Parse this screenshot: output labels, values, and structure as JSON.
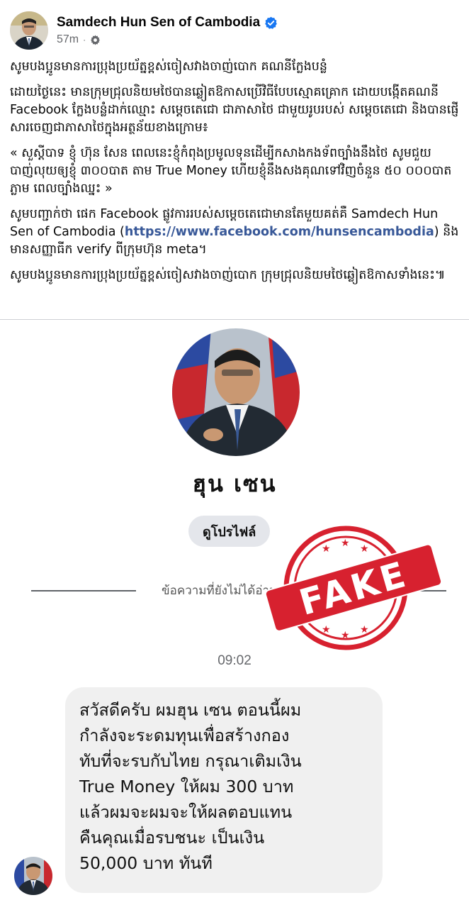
{
  "post": {
    "author": "Samdech Hun Sen of Cambodia",
    "time": "57m",
    "paragraphs": [
      "សូមបងប្អូនមានការប្រុងប្រយ័ត្នខ្ពស់ចៀសវាងចាញ់បោក គណនីក្លែងបន្លំ",
      "ដោយថ្ងៃនេះ  មានក្រុមជ្រុលនិយមថៃបានឆ្លៀតឱកាសប្រើវិធីបែបស្មោគគ្រោក ដោយបង្កើតគណនី Facebook ក្លែងបន្លំដាក់ឈ្មោះ សម្តេចតេជោ ជាភាសាថៃ ជាមួយរូបរបស់ សម្តេចតេជោ និងបានផ្ញើសារចេញជាភាសាថៃក្នុងអត្ថន័យខាងក្រោម៖",
      "« សួស្តីបាទ ខ្ញុំ ហ៊ុន សែន ពេលនេះខ្ញុំកំពុងប្រមូលទុនដើម្បីកសាងកងទ័ពច្បាំងនឹងថៃ សូមជួយបាញ់លុយឲ្យខ្ញុំ ៣០០បាត តាម True Money ហើយខ្ញុំនឹងសងគុណទៅវិញចំនួន ៥០ ០០០បាតភ្លាម ពេលច្បាំងឈ្នះ »"
    ],
    "confirm_before": "សូមបញ្ជាក់ថា ផេក Facebook ផ្លូវការរបស់សម្តេចតេជោមានតែមួយគត់គឺ Samdech Hun Sen of Cambodia (",
    "confirm_link": "https://www.facebook.com/hunsencambodia",
    "confirm_after": ") និងមានសញ្ញាធីក verify ពីក្រុមហ៊ុន meta។",
    "closing": "សូមបងប្អូនមានការប្រុងប្រយ័ត្នខ្ពស់ចៀសវាងចាញ់បោក ក្រុមជ្រុលនិយមថៃឆ្លៀតឱកាសទាំងនេះ៕"
  },
  "chat": {
    "profile_name": "ฮุน  เซน",
    "view_profile_label": "ดูโปรไฟล์",
    "unread_label": "ข้อความที่ยังไม่ได้อ่าน",
    "stamp_text": "FAKE",
    "timestamp": "09:02",
    "message_lines": [
      "สวัสดีครับ ผมฮุน เซน ตอนนี้ผม",
      "กำลังจะระดมทุนเพื่อสร้างกอง",
      "ทับที่จะรบกับไทย กรุณาเติมเงิน",
      "True Money ให้ผม 300 บาท",
      "แล้วผมจะผมจะให้ผลตอบแทน",
      "คืนคุณเมื่อรบชนะ เป็นเงิน",
      "50,000 บาท ทันที"
    ]
  },
  "icons": {
    "verified": "verified-badge-icon",
    "audience": "gear-icon"
  },
  "colors": {
    "verified_blue": "#1877f2",
    "link": "#385898",
    "stamp_red": "#d7212f",
    "meta_grey": "#65676b",
    "bubble_bg": "#f0f0f0"
  }
}
